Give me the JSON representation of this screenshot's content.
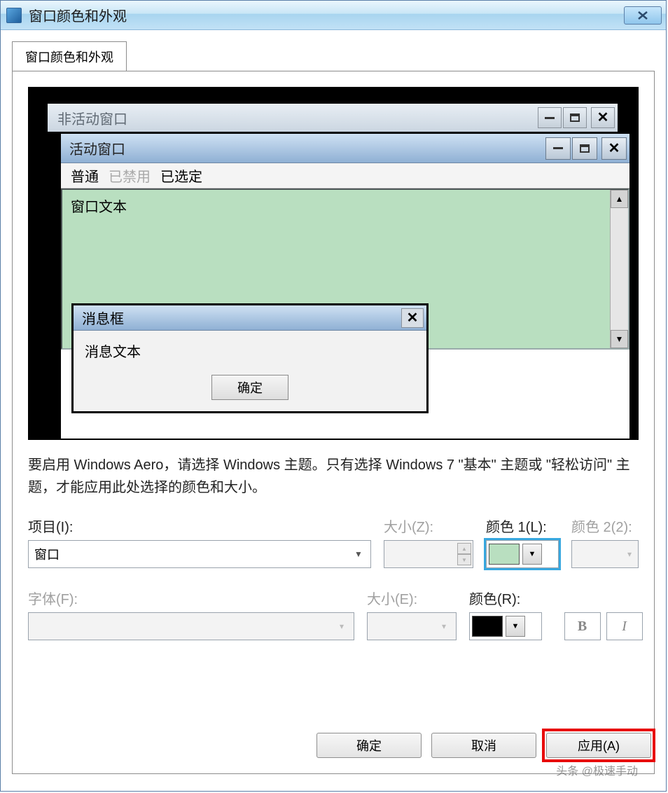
{
  "title": "窗口颜色和外观",
  "tab_label": "窗口颜色和外观",
  "preview": {
    "inactive_window_title": "非活动窗口",
    "active_window_title": "活动窗口",
    "menu": {
      "normal": "普通",
      "disabled": "已禁用",
      "selected": "已选定"
    },
    "window_text": "窗口文本",
    "msgbox": {
      "title": "消息框",
      "text": "消息文本",
      "ok": "确定"
    }
  },
  "instruction": "要启用 Windows Aero，请选择 Windows 主题。只有选择 Windows 7 \"基本\" 主题或 \"轻松访问\" 主题，才能应用此处选择的颜色和大小。",
  "labels": {
    "item": "项目(I):",
    "size_z": "大小(Z):",
    "color1": "颜色 1(L):",
    "color2": "颜色 2(2):",
    "font": "字体(F):",
    "size_e": "大小(E):",
    "color_r": "颜色(R):"
  },
  "item_value": "窗口",
  "colors": {
    "color1": "#b9dfc0",
    "color_r": "#000000"
  },
  "style_buttons": {
    "bold": "B",
    "italic": "I"
  },
  "dialog_buttons": {
    "ok": "确定",
    "cancel": "取消",
    "apply": "应用(A)"
  },
  "watermark": "头条 @极速手动"
}
